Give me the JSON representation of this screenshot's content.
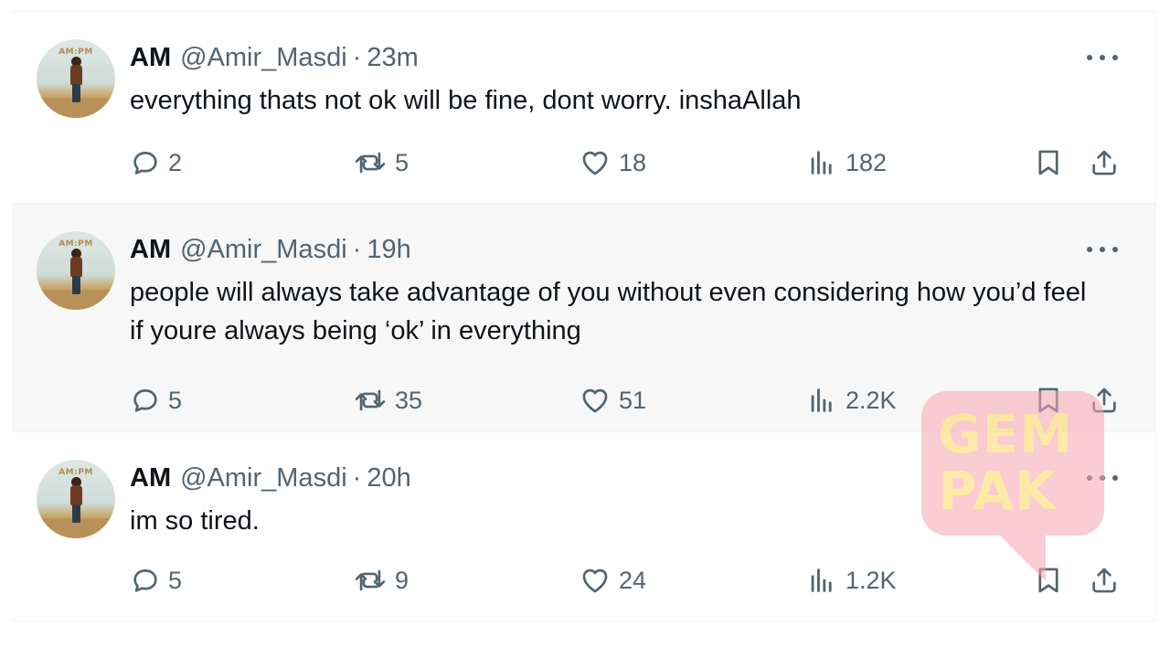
{
  "tweets": [
    {
      "name": "AM",
      "handle": "@Amir_Masdi",
      "separator": "·",
      "time": "23m",
      "text": "everything thats not ok will be fine, dont worry. inshaAllah",
      "avatar_brand": "AM:PM",
      "replies": "2",
      "retweets": "5",
      "likes": "18",
      "views": "182"
    },
    {
      "name": "AM",
      "handle": "@Amir_Masdi",
      "separator": "·",
      "time": "19h",
      "text": "people will always take advantage of you without even considering how you’d feel if youre always being ‘ok’ in everything",
      "avatar_brand": "AM:PM",
      "replies": "5",
      "retweets": "35",
      "likes": "51",
      "views": "2.2K"
    },
    {
      "name": "AM",
      "handle": "@Amir_Masdi",
      "separator": "·",
      "time": "20h",
      "text": "im so tired.",
      "avatar_brand": "AM:PM",
      "replies": "5",
      "retweets": "9",
      "likes": "24",
      "views": "1.2K"
    }
  ],
  "icons": {
    "reply": "reply-icon",
    "retweet": "retweet-icon",
    "like": "heart-icon",
    "views": "views-chart-icon",
    "bookmark": "bookmark-icon",
    "share": "share-icon",
    "more": "more-dots-icon"
  },
  "watermark": {
    "line1": "GEM",
    "line2": "PAK"
  },
  "colors": {
    "text_primary": "#0f1419",
    "text_secondary": "#536471",
    "highlight_bg": "#f7f7f7",
    "divider": "#eff3f4",
    "watermark_pink": "#f7a4b2",
    "watermark_yellow": "#ffd860"
  }
}
